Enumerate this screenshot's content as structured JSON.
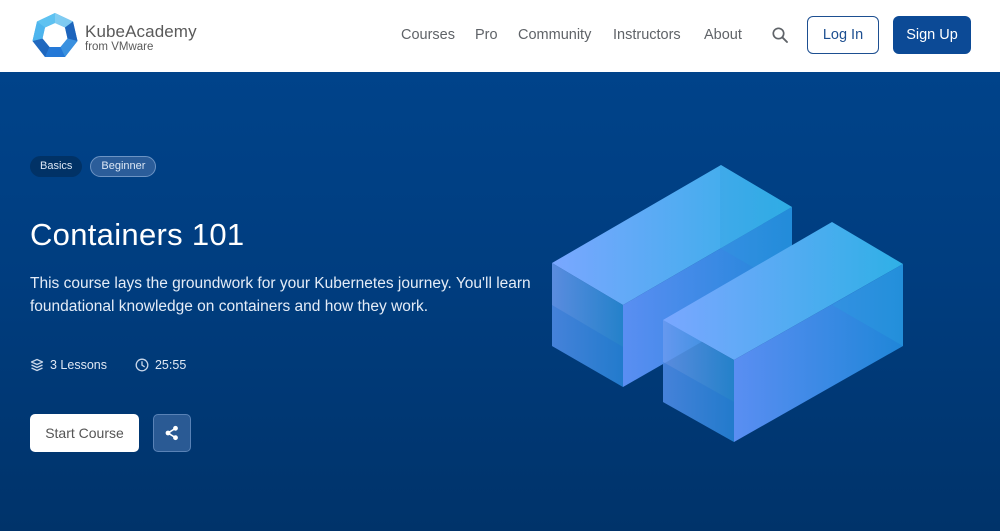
{
  "brand": {
    "name": "KubeAcademy",
    "subtitle": "from VMware",
    "logo_icon": "heptagon-ring-logo"
  },
  "nav": {
    "links": [
      "Courses",
      "Pro",
      "Community",
      "Instructors",
      "About"
    ],
    "search_icon": "search-icon",
    "login_label": "Log In",
    "signup_label": "Sign Up"
  },
  "hero": {
    "tags": [
      "Basics",
      "Beginner"
    ],
    "title": "Containers 101",
    "description": "This course lays the groundwork for your Kubernetes journey. You'll learn foundational knowledge on containers and how they work.",
    "lessons": "3 Lessons",
    "lessons_icon": "layers-icon",
    "duration": "25:55",
    "duration_icon": "clock-icon",
    "start_label": "Start Course",
    "share_icon": "share-icon",
    "illustration": "isometric-containers"
  },
  "colors": {
    "brand_dark": "#0c4a96",
    "hero_top": "#00438a",
    "hero_bottom": "#00336a",
    "nav_text": "#5f6368",
    "box_light": "#7aa7ff",
    "box_cyan": "#2fb0e6"
  }
}
